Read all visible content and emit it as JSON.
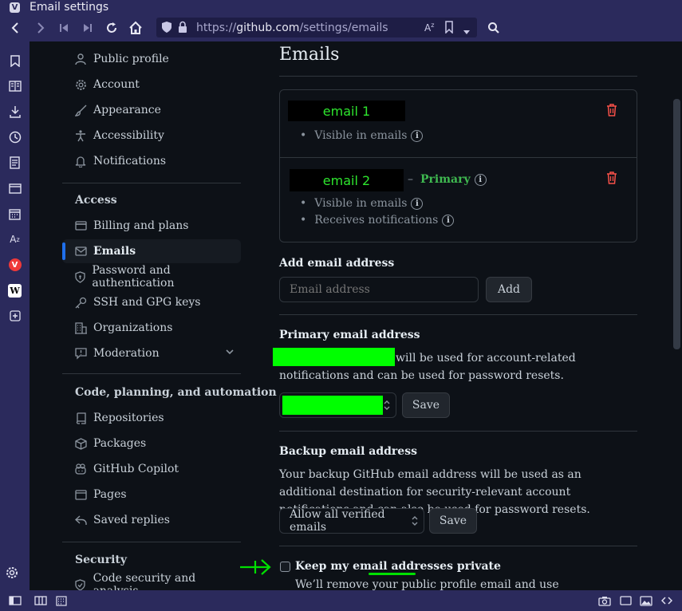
{
  "window": {
    "title": "Email settings",
    "app_icon": "vivaldi-logo-icon"
  },
  "toolbar": {
    "url_prefix": "https://",
    "url_host": "github.com",
    "url_path": "/settings/emails",
    "icons": [
      "back-icon",
      "forward-icon",
      "rewind-icon",
      "fast-forward-icon",
      "reload-icon",
      "home-icon",
      "shield-icon",
      "lock-icon",
      "translate-icon",
      "bookmark-icon",
      "dropdown-icon",
      "search-icon"
    ]
  },
  "side_panel": [
    "bookmarks-icon",
    "reading-list-icon",
    "downloads-icon",
    "history-icon",
    "notes-icon",
    "window-panel-icon",
    "calendar-icon",
    "translate-icon",
    "vivaldi-icon",
    "wikipedia-icon",
    "add-panel-icon",
    "settings-icon"
  ],
  "nav": {
    "top_items": [
      {
        "label": "Public profile",
        "icon": "person-icon"
      },
      {
        "label": "Account",
        "icon": "gear-icon"
      },
      {
        "label": "Appearance",
        "icon": "paintbrush-icon"
      },
      {
        "label": "Accessibility",
        "icon": "accessibility-icon"
      },
      {
        "label": "Notifications",
        "icon": "bell-icon"
      }
    ],
    "access_heading": "Access",
    "access_items": [
      {
        "label": "Billing and plans",
        "icon": "credit-card-icon"
      },
      {
        "label": "Emails",
        "icon": "mail-icon",
        "active": true
      },
      {
        "label": "Password and authentication",
        "icon": "shield-lock-icon"
      },
      {
        "label": "SSH and GPG keys",
        "icon": "key-icon"
      },
      {
        "label": "Organizations",
        "icon": "organization-icon"
      },
      {
        "label": "Moderation",
        "icon": "report-icon",
        "expandable": true
      }
    ],
    "code_heading": "Code, planning, and automation",
    "code_items": [
      {
        "label": "Repositories",
        "icon": "repo-icon"
      },
      {
        "label": "Packages",
        "icon": "package-icon"
      },
      {
        "label": "GitHub Copilot",
        "icon": "copilot-icon"
      },
      {
        "label": "Pages",
        "icon": "browser-icon"
      },
      {
        "label": "Saved replies",
        "icon": "reply-icon"
      }
    ],
    "security_heading": "Security",
    "security_items": [
      {
        "label": "Code security and analysis",
        "icon": "shield-check-icon"
      }
    ]
  },
  "main": {
    "title": "Emails",
    "emails": [
      {
        "address_label": "email 1",
        "bullets": [
          "Visible in emails"
        ]
      },
      {
        "address_label": "email 2",
        "primary_dash": "–",
        "primary_label": "Primary",
        "bullets": [
          "Visible in emails",
          "Receives notifications"
        ]
      }
    ],
    "add": {
      "label": "Add email address",
      "placeholder": "Email address",
      "button": "Add"
    },
    "primary": {
      "label": "Primary email address",
      "text_after": "will be used for account-related notifications and can be used for password resets.",
      "save": "Save"
    },
    "backup": {
      "label": "Backup email address",
      "text": "Your backup GitHub email address will be used as an additional destination for security-relevant account notifications and can also be used for password resets.",
      "selected": "Allow all verified emails",
      "save": "Save"
    },
    "private": {
      "label": "Keep my email addresses private",
      "note": "We’ll remove your public profile email and use"
    }
  },
  "colors": {
    "accent": "#1f6feb",
    "primary_green": "#3fb950",
    "danger": "#f85149",
    "redaction_green": "#00ff00",
    "chrome": "#2b2a5c"
  }
}
